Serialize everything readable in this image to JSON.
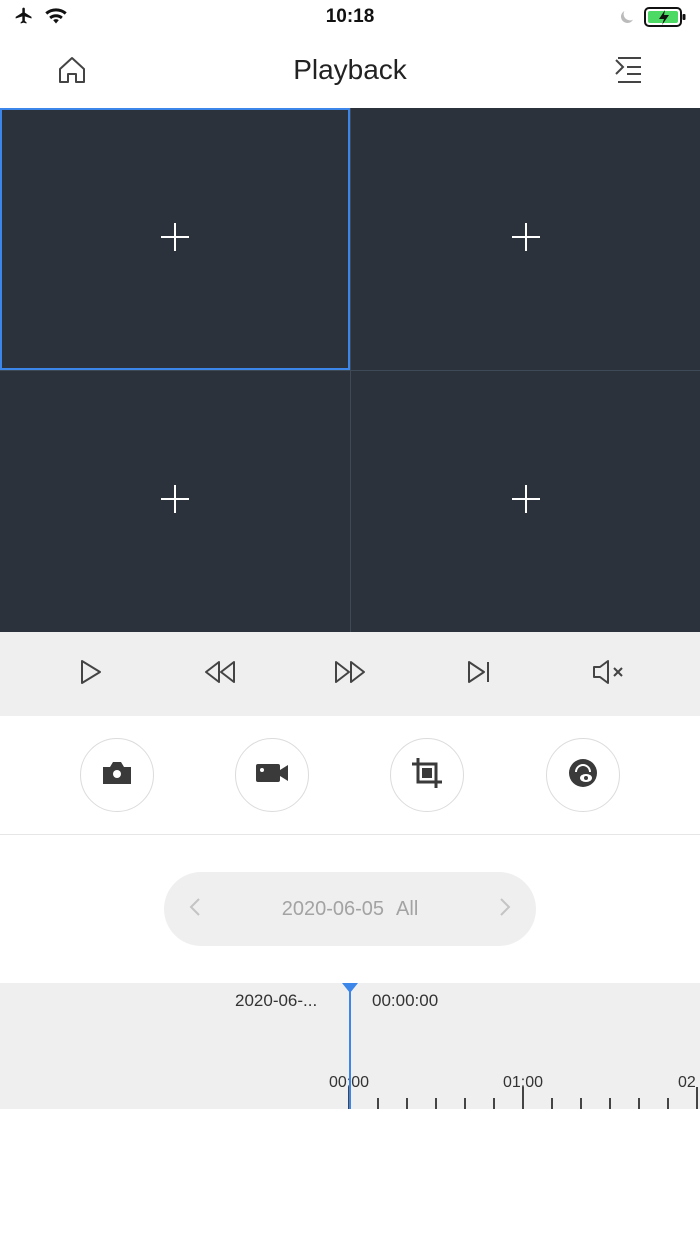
{
  "status_bar": {
    "time": "10:18",
    "left_icons": [
      "airplane-icon",
      "wifi-icon"
    ],
    "right_icons": [
      "moon-icon",
      "battery-charging-icon"
    ]
  },
  "header": {
    "title": "Playback",
    "left_icon": "home-icon",
    "right_icon": "device-list-icon"
  },
  "video_grid": {
    "cells": [
      {
        "icon": "add-icon",
        "selected": true
      },
      {
        "icon": "add-icon",
        "selected": false
      },
      {
        "icon": "add-icon",
        "selected": false
      },
      {
        "icon": "add-icon",
        "selected": false
      }
    ]
  },
  "controls": {
    "icons": [
      "play-icon",
      "rewind-icon",
      "fast-forward-icon",
      "skip-next-icon",
      "mute-icon"
    ]
  },
  "tools": {
    "icons": [
      "snapshot-icon",
      "record-icon",
      "crop-icon",
      "fisheye-icon"
    ]
  },
  "date_selector": {
    "date": "2020-06-05",
    "filter": "All",
    "prev_icon": "chevron-left-icon",
    "next_icon": "chevron-right-icon"
  },
  "timeline": {
    "current_date": "2020-06-...",
    "current_time": "00:00:00",
    "tick_labels": [
      "00:00",
      "01:00",
      "02"
    ]
  },
  "colors": {
    "accent": "#3b86e8",
    "video_bg": "#2b323c",
    "panel_bg": "#efefef",
    "muted_text": "#a3a3a3"
  }
}
